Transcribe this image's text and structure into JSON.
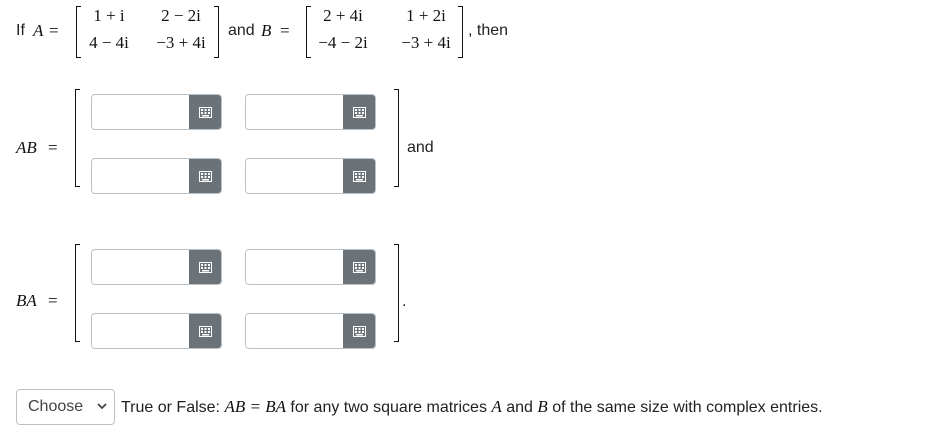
{
  "question": {
    "if_label": "If",
    "matrix_a_name": "A",
    "equals": "=",
    "and_label": "and",
    "matrix_b_name": "B",
    "then_label": ", then",
    "matrix_a": [
      [
        "1 + i",
        "2 − 2i"
      ],
      [
        "4 − 4i",
        "−3 + 4i"
      ]
    ],
    "matrix_b": [
      [
        "2 + 4i",
        "1 + 2i"
      ],
      [
        "−4 − 2i",
        "−3 + 4i"
      ]
    ]
  },
  "ab_section": {
    "label": "AB",
    "equals": "=",
    "trailing_text": "and",
    "inputs": [
      {
        "value": "",
        "placeholder": ""
      },
      {
        "value": "",
        "placeholder": ""
      },
      {
        "value": "",
        "placeholder": ""
      },
      {
        "value": "",
        "placeholder": ""
      }
    ]
  },
  "ba_section": {
    "label": "BA",
    "equals": "=",
    "trailing_text": ".",
    "inputs": [
      {
        "value": "",
        "placeholder": ""
      },
      {
        "value": "",
        "placeholder": ""
      },
      {
        "value": "",
        "placeholder": ""
      },
      {
        "value": "",
        "placeholder": ""
      }
    ]
  },
  "true_false": {
    "select_value": "Choose",
    "statement_prefix": "True or False:",
    "statement_math": "AB = BA",
    "statement_suffix": "for any two square matrices",
    "var_a": "A",
    "connector": "and",
    "var_b": "B",
    "statement_end": "of the same size with complex entries."
  },
  "icons": {
    "keyboard": "keyboard-icon",
    "chevron": "chevron-down-icon"
  },
  "colors": {
    "keyboard_button": "#6b7378",
    "input_border": "#b9c1c9",
    "text": "#222222"
  }
}
